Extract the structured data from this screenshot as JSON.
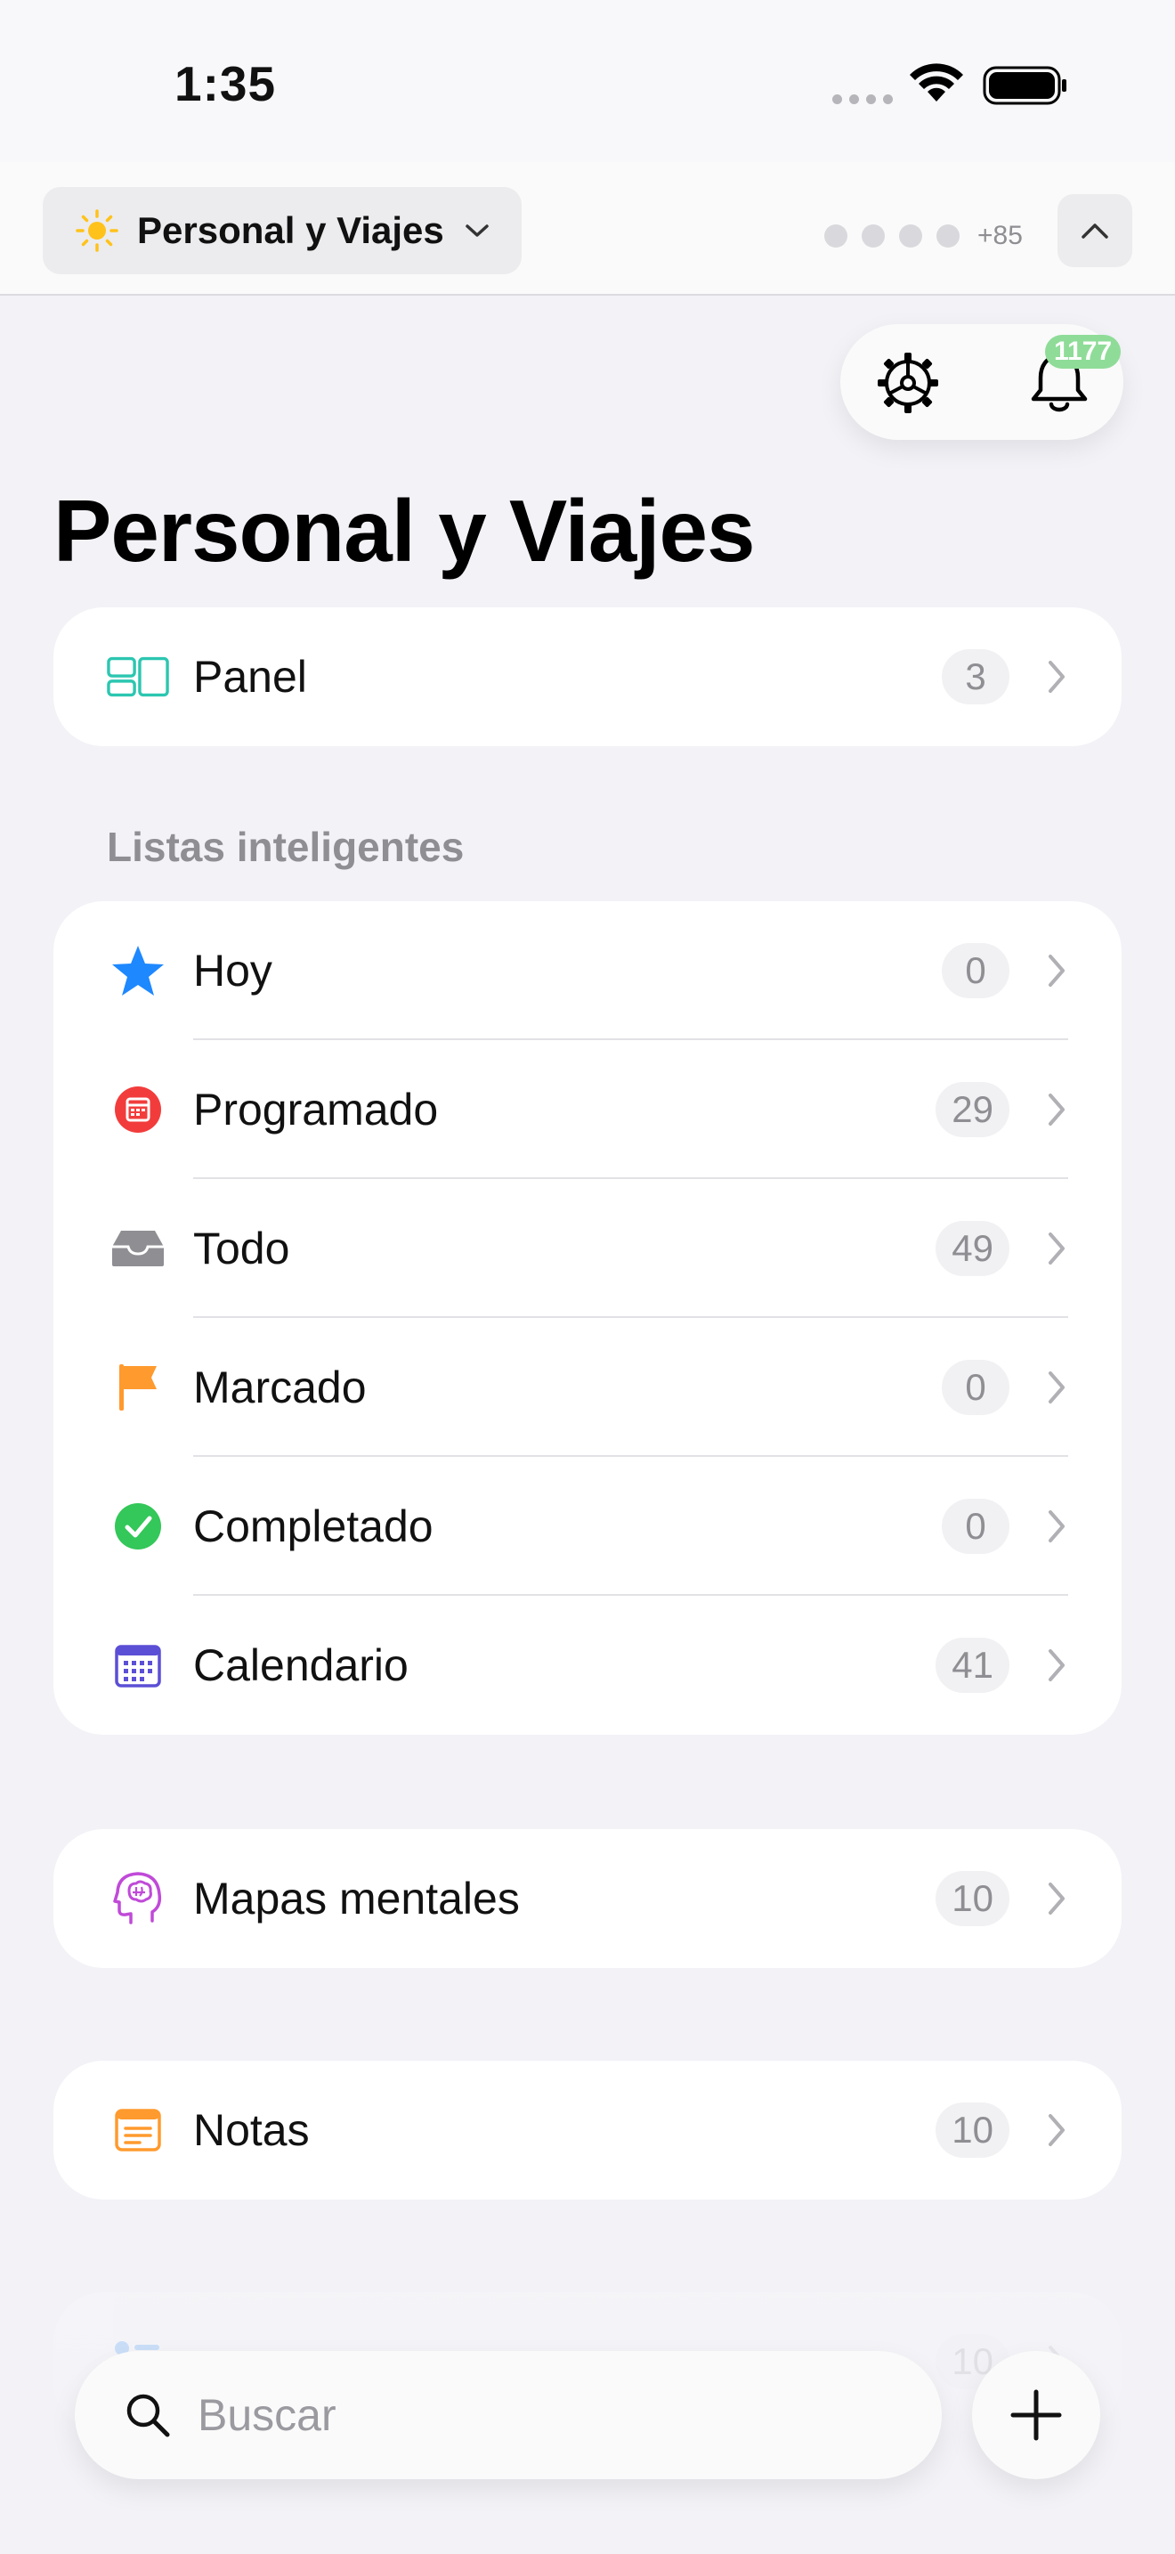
{
  "status_bar": {
    "time": "1:35"
  },
  "workspace": {
    "name": "Personal y Viajes",
    "members_more": "+85"
  },
  "notifications": {
    "count": "1177"
  },
  "page": {
    "title": "Personal y Viajes"
  },
  "panel": {
    "label": "Panel",
    "count": "3"
  },
  "smart_lists": {
    "heading": "Listas inteligentes",
    "items": [
      {
        "label": "Hoy",
        "count": "0",
        "icon": "star-icon"
      },
      {
        "label": "Programado",
        "count": "29",
        "icon": "calendar-red-icon"
      },
      {
        "label": "Todo",
        "count": "49",
        "icon": "inbox-icon"
      },
      {
        "label": "Marcado",
        "count": "0",
        "icon": "flag-icon"
      },
      {
        "label": "Completado",
        "count": "0",
        "icon": "check-circle-icon"
      },
      {
        "label": "Calendario",
        "count": "41",
        "icon": "calendar-grid-icon"
      }
    ]
  },
  "mind_maps": {
    "label": "Mapas mentales",
    "count": "10"
  },
  "notes": {
    "label": "Notas",
    "count": "10"
  },
  "partial_row": {
    "count": "10"
  },
  "search": {
    "placeholder": "Buscar"
  },
  "colors": {
    "accent_blue": "#1e88ff",
    "red": "#f23c3c",
    "orange": "#ff9a2e",
    "green": "#34c759",
    "purple": "#5b4fd6",
    "teal": "#2cc6b0",
    "magenta": "#c04ad8"
  }
}
